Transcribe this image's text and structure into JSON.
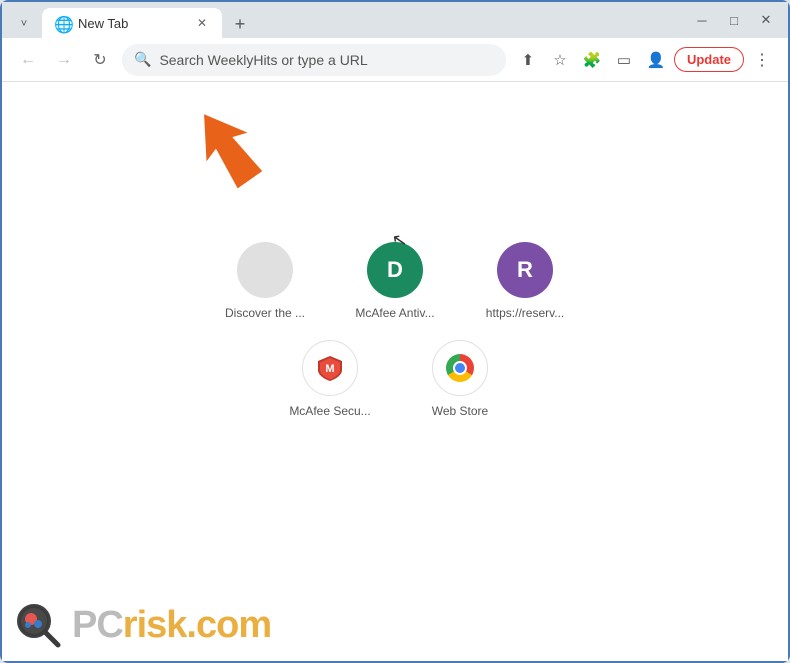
{
  "titleBar": {
    "tab": {
      "title": "New Tab",
      "favicon": "🌐"
    },
    "newTabLabel": "+",
    "windowControls": {
      "minimize": "─",
      "maximize": "□",
      "close": "✕",
      "chevron": "˅"
    }
  },
  "navBar": {
    "backLabel": "←",
    "forwardLabel": "→",
    "reloadLabel": "↻",
    "addressPlaceholder": "Search WeeklyHits or type a URL",
    "shareIcon": "⬆",
    "bookmarkIcon": "☆",
    "extensionIcon": "🧩",
    "sidebarIcon": "▭",
    "profileIcon": "👤",
    "updateLabel": "Update",
    "menuLabel": "⋮"
  },
  "shortcuts": {
    "row1": [
      {
        "id": "discover",
        "label": "Discover the ...",
        "iconType": "gray",
        "iconText": ""
      },
      {
        "id": "mcafee-antiv",
        "label": "McAfee Antiv...",
        "iconType": "green",
        "iconText": "D"
      },
      {
        "id": "https-reserv",
        "label": "https://reserv...",
        "iconType": "purple",
        "iconText": "R"
      }
    ],
    "row2": [
      {
        "id": "mcafee-secu",
        "label": "McAfee Secu...",
        "iconType": "mcafee-red",
        "iconText": "shield"
      },
      {
        "id": "web-store",
        "label": "Web Store",
        "iconType": "webstore",
        "iconText": "chrome"
      }
    ]
  },
  "pcrisk": {
    "text1": "PC",
    "text2": "risk.com"
  }
}
